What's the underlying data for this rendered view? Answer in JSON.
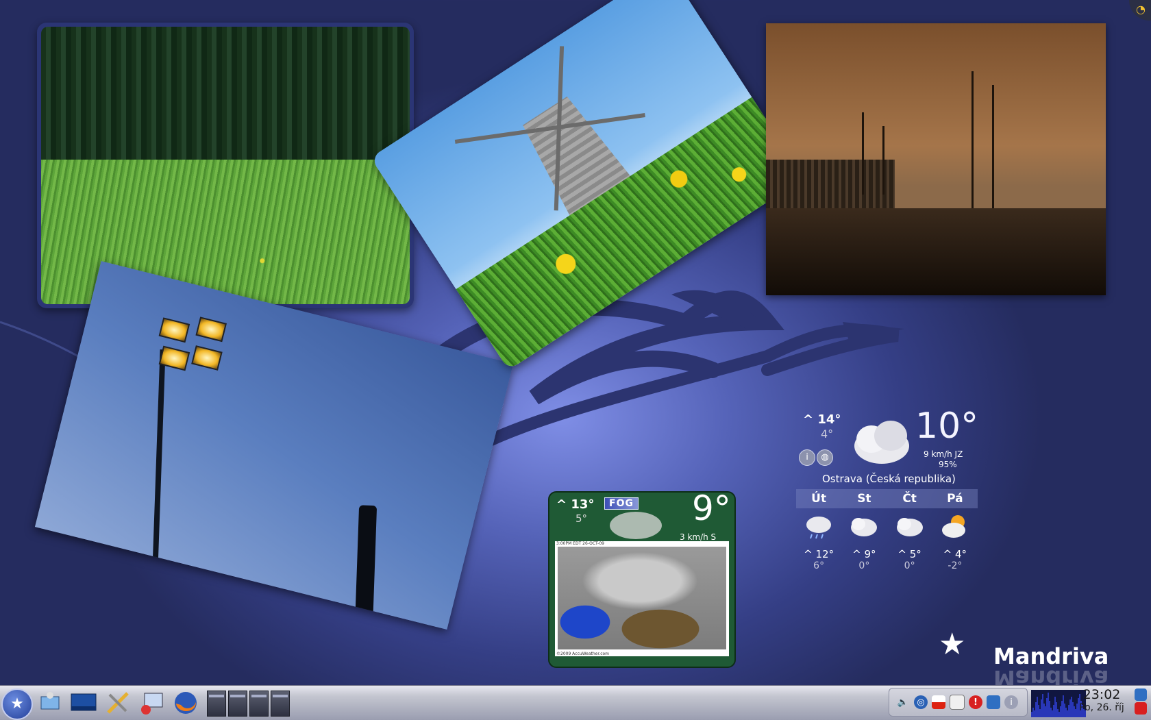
{
  "weather_main": {
    "high": "^ 14°",
    "low": "4°",
    "temperature": "10°",
    "wind": "9 km/h JZ",
    "humidity": "95%",
    "location": "Ostrava (Česká republika)",
    "forecast": [
      {
        "day": "Út",
        "high": "^ 12°",
        "low": "6°",
        "icon": "rain-cloud-icon"
      },
      {
        "day": "St",
        "high": "^ 9°",
        "low": "0°",
        "icon": "cloud-icon"
      },
      {
        "day": "Čt",
        "high": "^ 5°",
        "low": "0°",
        "icon": "cloud-icon"
      },
      {
        "day": "Pá",
        "high": "^ 4°",
        "low": "-2°",
        "icon": "sun-cloud-icon"
      }
    ]
  },
  "weather_secondary": {
    "high": "^ 13°",
    "low": "5°",
    "condition": "FOG",
    "temperature": "9°",
    "wind": "3 km/h S",
    "map_stamp": "3:00PM EDT 26-OCT-09",
    "map_footer": "©2009 AccuWeather.com"
  },
  "logo": {
    "name": "Mandriva"
  },
  "clock": {
    "time": "23:02",
    "date": "Po, 26. říj"
  },
  "taskbar": {
    "launchers": [
      "kde-menu-icon",
      "network-icon",
      "desktop-icon",
      "tools-icon",
      "control-center-icon",
      "firefox-icon"
    ],
    "pager_desktops": 4,
    "tray_icons": [
      "volume-icon",
      "network-globe-icon",
      "keyboard-layout-icon",
      "clipboard-icon",
      "update-warning-icon",
      "network-monitor-icon",
      "info-icon"
    ]
  },
  "colors": {
    "desktop_bg": "#4a56a8",
    "widget_green": "#1f5a35",
    "fog_badge": "#3e4fb7",
    "taskbar": "#c4c6d0"
  }
}
